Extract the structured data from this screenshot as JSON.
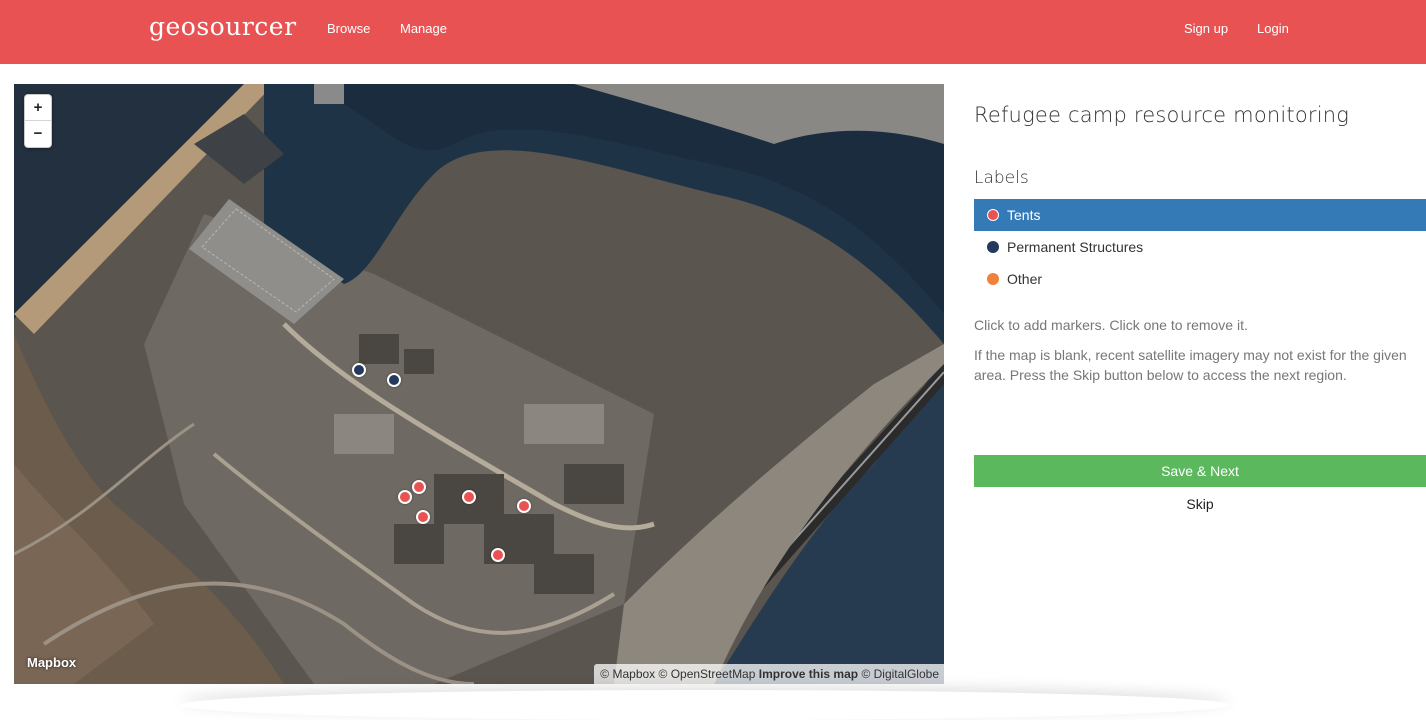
{
  "nav": {
    "brand": "geosourcer",
    "links": [
      "Browse",
      "Manage"
    ],
    "right_links": [
      "Sign up",
      "Login"
    ]
  },
  "map": {
    "zoom_in": "+",
    "zoom_out": "−",
    "logo": "Mapbox",
    "attribution": {
      "mapbox": "© Mapbox",
      "osm": "© OpenStreetMap",
      "improve": "Improve this map",
      "digitalglobe": "© DigitalGlobe"
    },
    "markers": {
      "tents": 6,
      "permanent_structures": 2,
      "other": 0
    }
  },
  "panel": {
    "title": "Refugee camp resource monitoring",
    "labels_heading": "Labels",
    "labels": [
      {
        "name": "Tents",
        "color": "#e95253",
        "active": true
      },
      {
        "name": "Permanent Structures",
        "color": "#233a5e",
        "active": false
      },
      {
        "name": "Other",
        "color": "#f0813b",
        "active": false
      }
    ],
    "help_1": "Click to add markers. Click one to remove it.",
    "help_2": "If the map is blank, recent satellite imagery may not exist for the given area. Press the Skip button below to access the next region.",
    "save_button": "Save & Next",
    "skip_button": "Skip"
  },
  "colors": {
    "navbar": "#e95253",
    "active_label": "#337ab7",
    "save_button": "#5cb85c",
    "tent_marker": "#e95253",
    "structure_marker": "#233a5e"
  }
}
